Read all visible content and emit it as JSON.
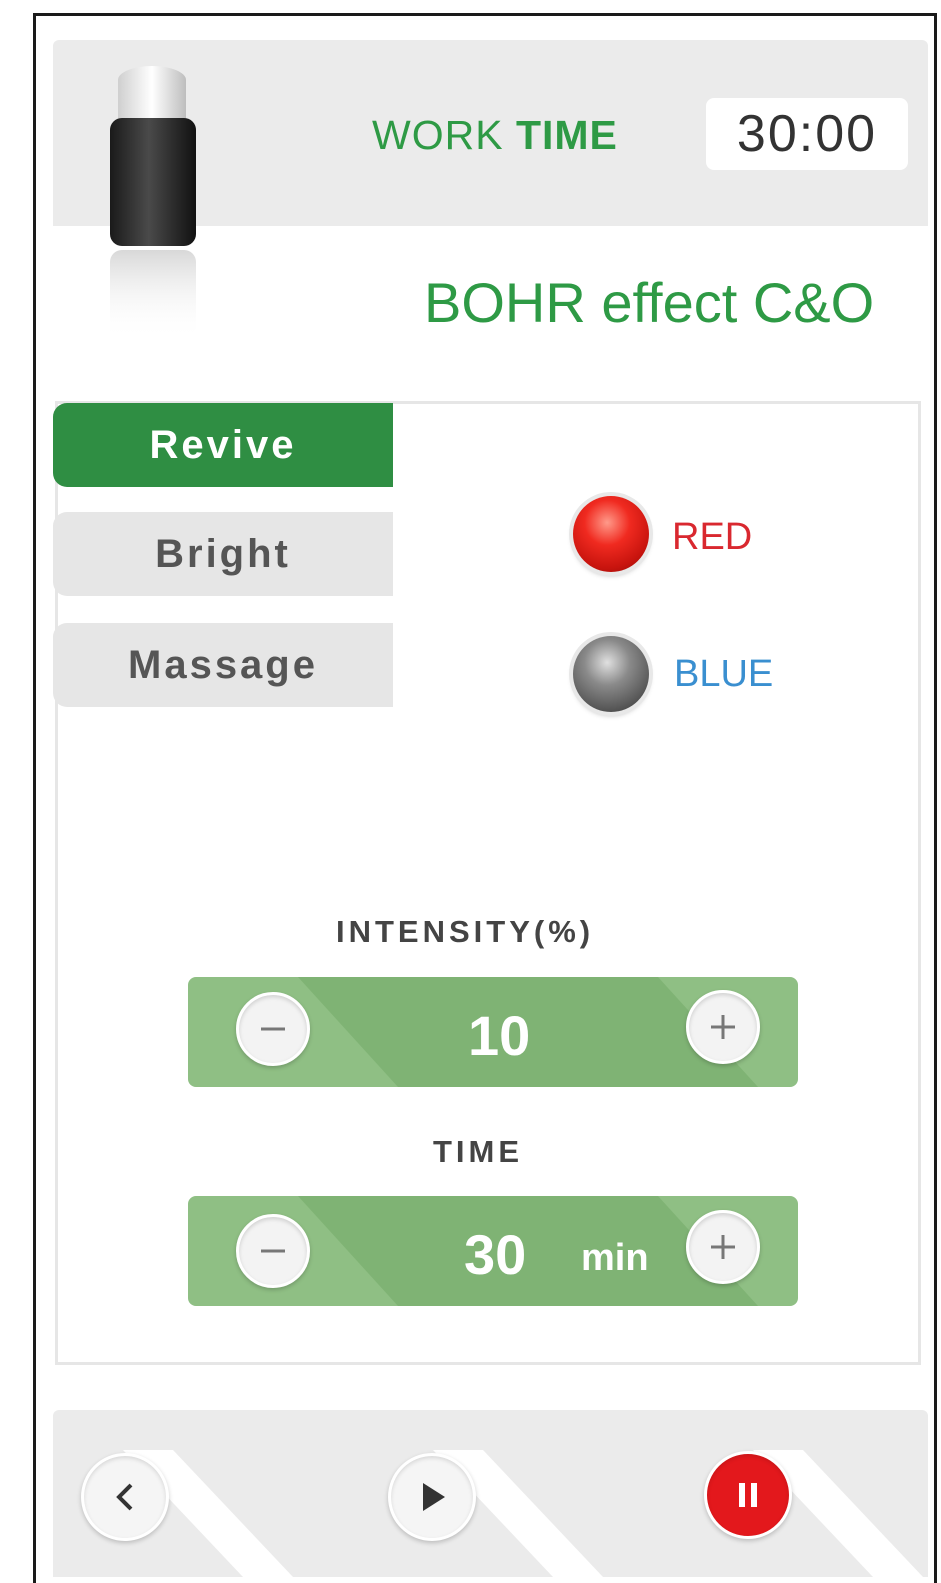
{
  "header": {
    "work_label_regular": "WORK",
    "work_label_bold": "TIME",
    "work_time": "30:00",
    "program_title": "BOHR effect C&O"
  },
  "tabs": [
    {
      "label": "Revive",
      "active": true
    },
    {
      "label": "Bright",
      "active": false
    },
    {
      "label": "Massage",
      "active": false
    }
  ],
  "leds": [
    {
      "label": "RED",
      "color": "#d9282f",
      "state": "on"
    },
    {
      "label": "BLUE",
      "color": "#3a8fd0",
      "state": "off"
    }
  ],
  "intensity": {
    "label": "INTENSITY(%)",
    "value": "10",
    "decrease_icon": "minus-icon",
    "increase_icon": "plus-icon"
  },
  "time": {
    "label": "TIME",
    "value": "30",
    "unit": "min",
    "decrease_icon": "minus-icon",
    "increase_icon": "plus-icon"
  },
  "footer": {
    "back_icon": "chevron-left-icon",
    "play_icon": "play-icon",
    "pause_icon": "pause-icon"
  },
  "colors": {
    "accent_green": "#2f8e43",
    "stepper_green": "#8fbf84",
    "pause_red": "#e3181c"
  }
}
